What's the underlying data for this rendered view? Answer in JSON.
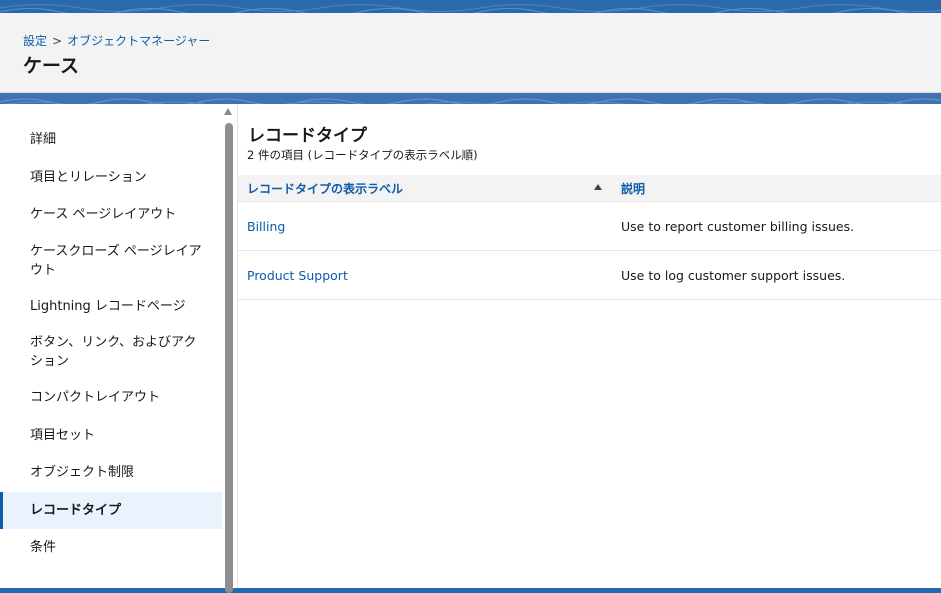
{
  "header": {
    "breadcrumb": {
      "setup": "設定",
      "separator": ">",
      "object_manager": "オブジェクトマネージャー"
    },
    "title": "ケース"
  },
  "sidebar": {
    "items": [
      {
        "label": "詳細",
        "active": false
      },
      {
        "label": "項目とリレーション",
        "active": false
      },
      {
        "label": "ケース ページレイアウト",
        "active": false
      },
      {
        "label": "ケースクローズ ページレイアウト",
        "active": false
      },
      {
        "label": "Lightning レコードページ",
        "active": false
      },
      {
        "label": "ボタン、リンク、およびアクション",
        "active": false
      },
      {
        "label": "コンパクトレイアウト",
        "active": false
      },
      {
        "label": "項目セット",
        "active": false
      },
      {
        "label": "オブジェクト制限",
        "active": false
      },
      {
        "label": "レコードタイプ",
        "active": true
      },
      {
        "label": "条件",
        "active": false
      }
    ]
  },
  "main": {
    "section_title": "レコードタイプ",
    "subtitle": "2 件の項目 (レコードタイプの表示ラベル順)",
    "table": {
      "columns": [
        "レコードタイプの表示ラベル",
        "説明"
      ],
      "rows": [
        {
          "label": "Billing",
          "description": "Use to report customer billing issues."
        },
        {
          "label": "Product Support",
          "description": "Use to log customer support issues."
        }
      ]
    }
  },
  "colors": {
    "brand_blue": "#0b5cab",
    "band_blue": "#2a6aab",
    "active_bg": "#e9f2fd"
  },
  "icons": {
    "sort": "arrow-up-icon",
    "scroll_up": "scroll-up-arrow-icon"
  }
}
